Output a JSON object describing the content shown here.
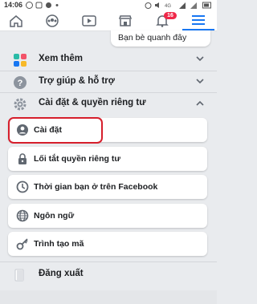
{
  "status_bar": {
    "time": "14:06",
    "left_icons": [
      "messenger-icon",
      "notification-icon",
      "network-icon",
      "notification-dot-icon"
    ],
    "right_icons": [
      "alarm-icon",
      "mute-icon",
      "signal-4g-icon",
      "signal-icon",
      "battery-icon"
    ]
  },
  "nav": {
    "items": [
      {
        "icon": "home-icon",
        "active": false
      },
      {
        "icon": "groups-icon",
        "active": false
      },
      {
        "icon": "watch-icon",
        "active": false
      },
      {
        "icon": "marketplace-icon",
        "active": false
      },
      {
        "icon": "bell-icon",
        "active": false,
        "badge": "16"
      },
      {
        "icon": "menu-icon",
        "active": true
      }
    ],
    "accent": "#1877f2"
  },
  "shortcut_card": {
    "label": "Bạn bè quanh đây"
  },
  "sections": {
    "see_more": {
      "label": "Xem thêm",
      "icon": "grid-icon"
    },
    "help": {
      "label": "Trợ giúp & hỗ trợ",
      "icon": "question-icon"
    },
    "settings_privacy": {
      "label": "Cài đặt & quyền riêng tư",
      "icon": "gear-icon"
    }
  },
  "settings_items": [
    {
      "label": "Cài đặt",
      "icon": "profile-settings-icon"
    },
    {
      "label": "Lối tắt quyền riêng tư",
      "icon": "lock-icon"
    },
    {
      "label": "Thời gian bạn ở trên Facebook",
      "icon": "clock-icon"
    },
    {
      "label": "Ngôn ngữ",
      "icon": "globe-icon"
    },
    {
      "label": "Trình tạo mã",
      "icon": "key-icon"
    }
  ],
  "logout": {
    "label": "Đăng xuất",
    "icon": "door-icon"
  },
  "colors": {
    "highlight": "#d61f2c",
    "badge": "#f02849"
  }
}
